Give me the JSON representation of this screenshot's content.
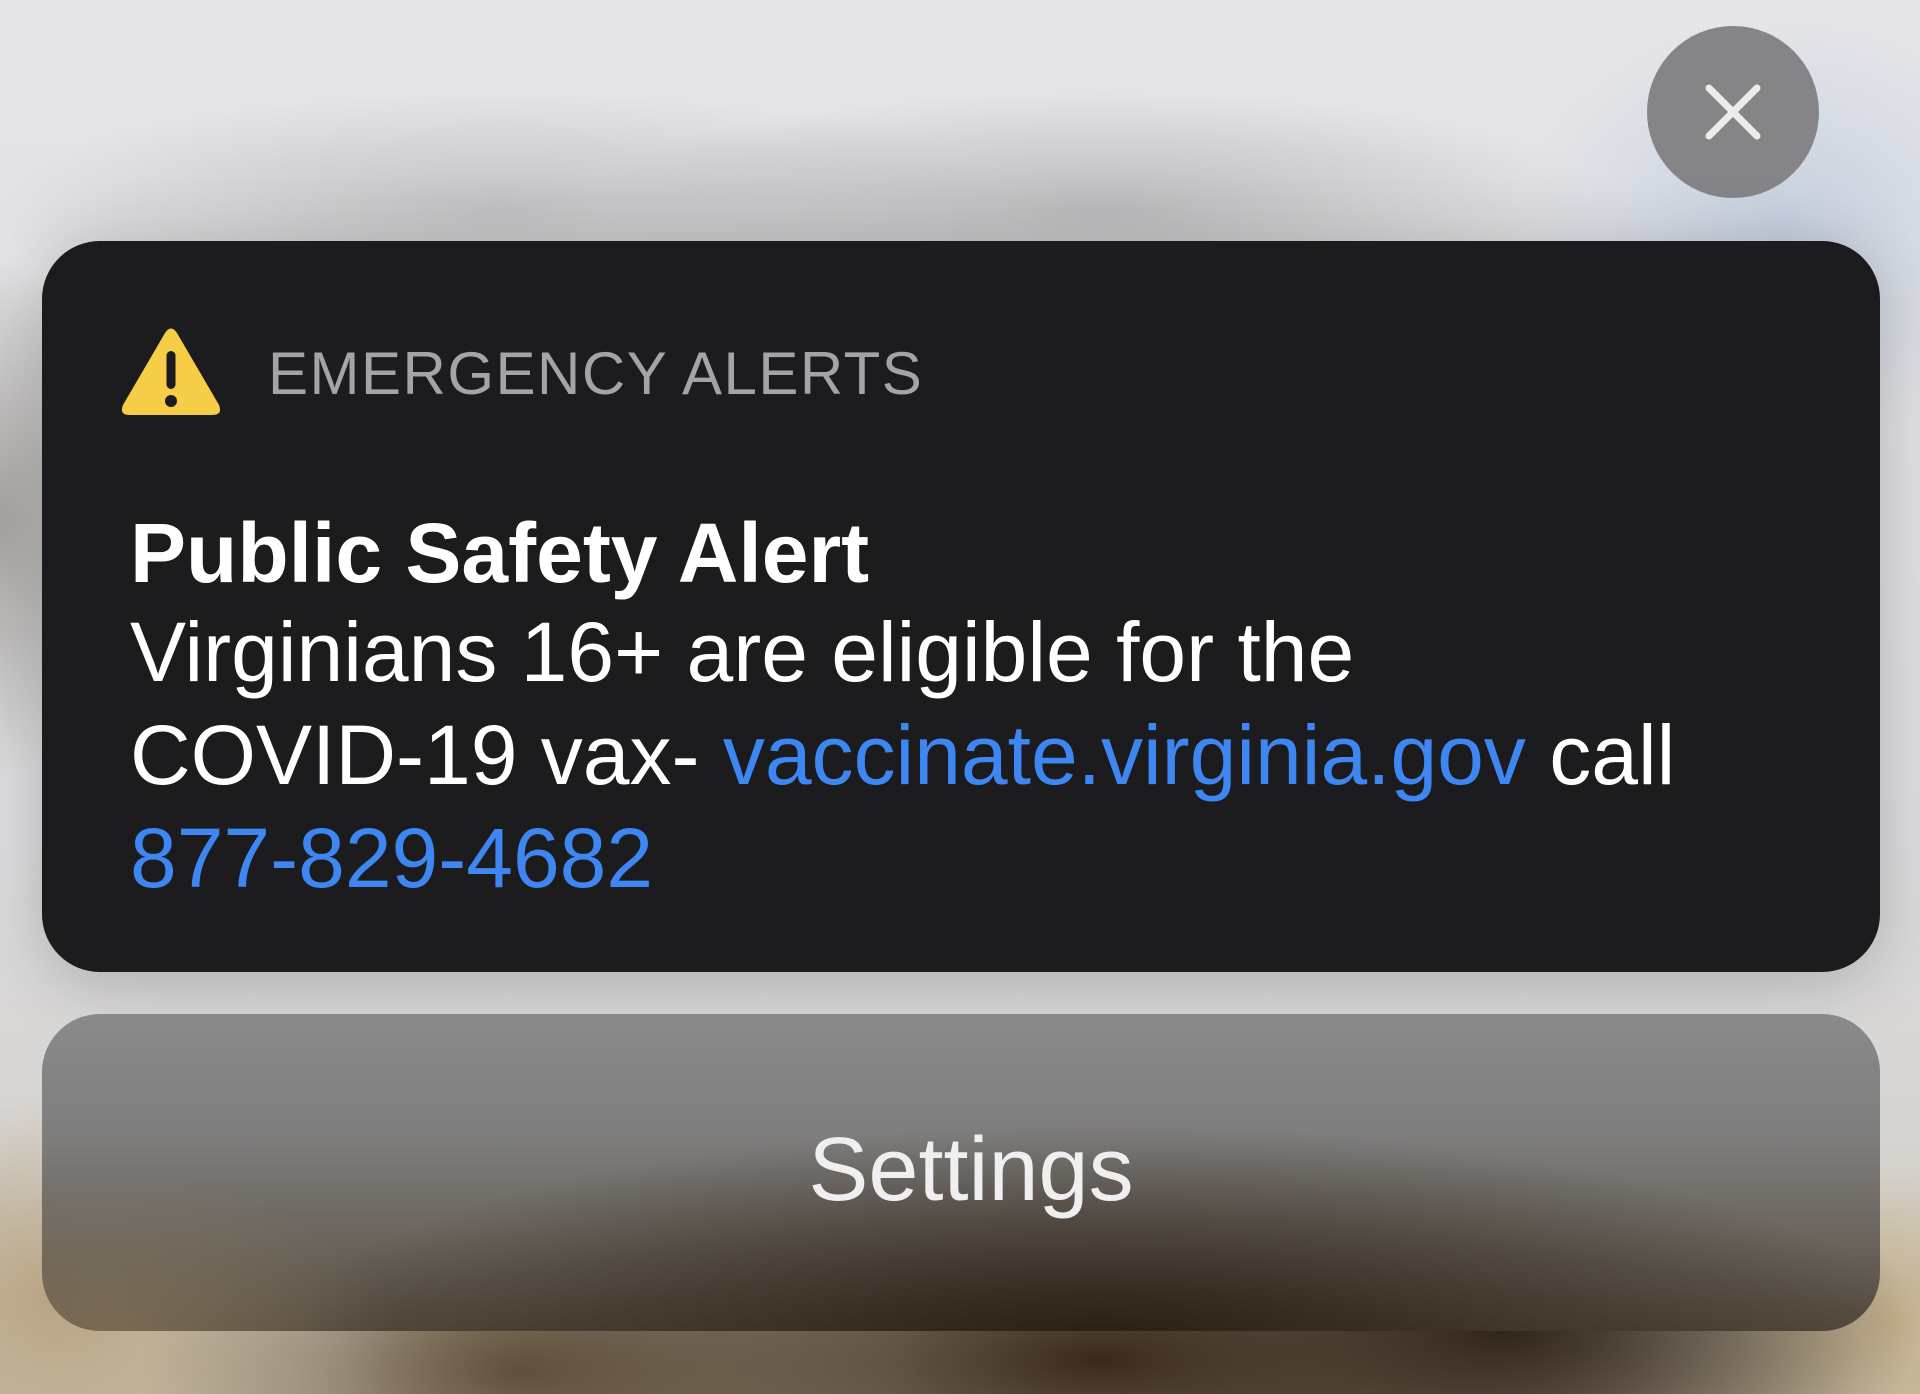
{
  "close_button": {
    "icon": "close-icon"
  },
  "alert": {
    "app_name": "EMERGENCY ALERTS",
    "icon": "warning-icon",
    "icon_color": "#f5cd47",
    "title": "Public Safety Alert",
    "body_line1": "Virginians 16+ are eligible for the",
    "body_line2_prefix": "COVID-19 vax- ",
    "link_url": "vaccinate.virginia.gov",
    "body_line2_suffix": " call",
    "phone_link": "877-829-4682",
    "link_color": "#3e87f2"
  },
  "settings_button": {
    "label": "Settings"
  }
}
